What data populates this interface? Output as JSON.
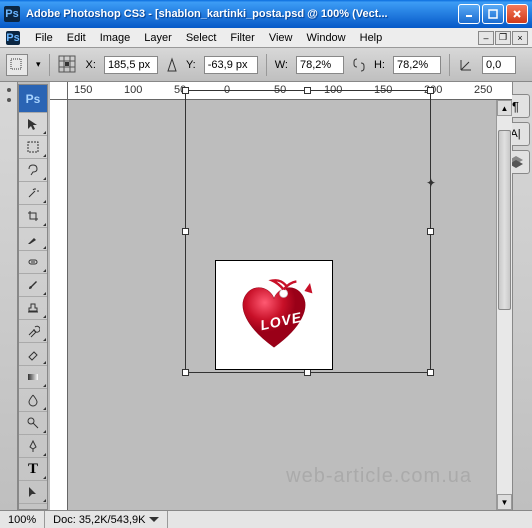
{
  "title": "Adobe Photoshop CS3 - [shablon_kartinki_posta.psd @ 100% (Vect...",
  "menus": [
    "File",
    "Edit",
    "Image",
    "Layer",
    "Select",
    "Filter",
    "View",
    "Window",
    "Help"
  ],
  "options": {
    "x_label": "X:",
    "x": "185,5 px",
    "y_label": "Y:",
    "y": "-63,9 px",
    "w_label": "W:",
    "w": "78,2%",
    "h_label": "H:",
    "h": "78,2%",
    "angle_label": "",
    "angle": "0,0"
  },
  "ruler_marks": [
    "150",
    "100",
    "50",
    "0",
    "50",
    "100",
    "150",
    "200",
    "250"
  ],
  "image_text": "LOVE",
  "status": {
    "zoom": "100%",
    "doc": "Doc: 35,2K/543,9K"
  },
  "watermark": "web-article.com.ua",
  "ps_badge": "Ps"
}
